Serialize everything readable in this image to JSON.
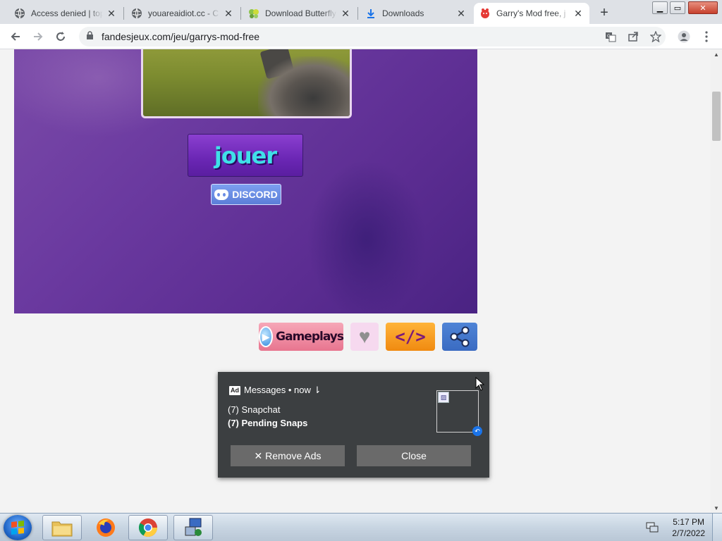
{
  "browser": {
    "tabs": [
      {
        "title": "Access denied | top",
        "active": false,
        "favicon": "globe-icon"
      },
      {
        "title": "youareaidiot.cc - C",
        "active": false,
        "favicon": "globe-icon"
      },
      {
        "title": "Download Butterfly",
        "active": false,
        "favicon": "butterfly-icon"
      },
      {
        "title": "Downloads",
        "active": false,
        "favicon": "download-icon"
      },
      {
        "title": "Garry's Mod free, j",
        "active": true,
        "favicon": "game-icon"
      }
    ],
    "tab_close_glyph": "✕",
    "new_tab_glyph": "+",
    "window_controls": {
      "minimize": "▁",
      "maximize": "▭",
      "close": "✕"
    },
    "url": "fandesjeux.com/jeu/garrys-mod-free"
  },
  "page": {
    "play_button_label": "jouer",
    "discord_label": "DISCORD",
    "gameplays_label": "Gameplays",
    "embed_label": "</>",
    "heart_glyph": "♥"
  },
  "ad_popup": {
    "badge": "Ad",
    "header": "Messages • now ⇂",
    "line1": "(7) Snapchat",
    "line2": "(7) Pending Snaps",
    "remove_ads_label": "✕ Remove Ads",
    "close_label": "Close"
  },
  "taskbar": {
    "time": "5:17 PM",
    "date": "2/7/2022",
    "apps": [
      "explorer-icon",
      "firefox-icon",
      "chrome-icon",
      "network-app-icon"
    ]
  }
}
